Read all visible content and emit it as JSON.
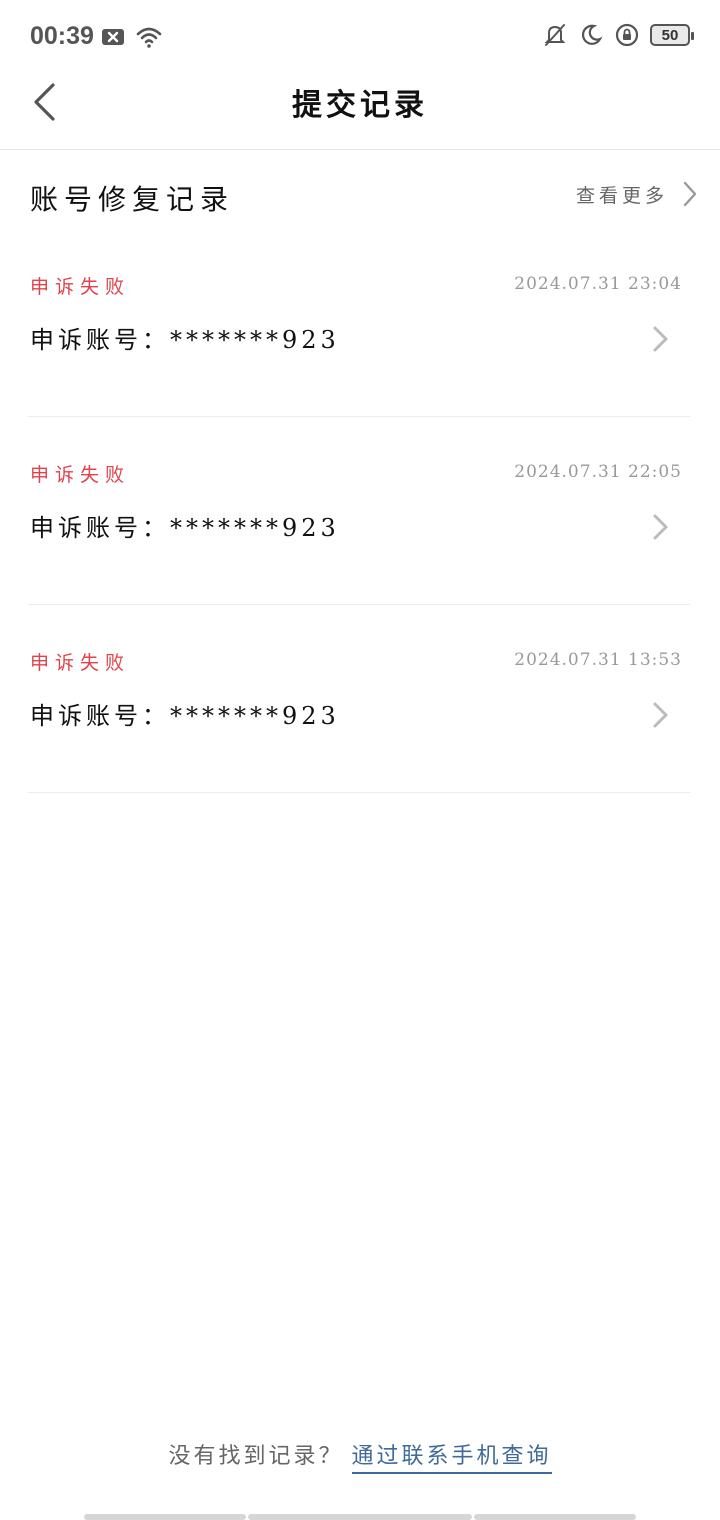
{
  "status_bar": {
    "time": "00:39",
    "battery": "50"
  },
  "nav": {
    "title": "提交记录"
  },
  "section": {
    "title": "账号修复记录",
    "view_more": "查看更多"
  },
  "records": [
    {
      "status": "申诉失败",
      "time": "2024.07.31  23:04",
      "account": "申诉账号：*******923"
    },
    {
      "status": "申诉失败",
      "time": "2024.07.31  22:05",
      "account": "申诉账号：*******923"
    },
    {
      "status": "申诉失败",
      "time": "2024.07.31  13:53",
      "account": "申诉账号：*******923"
    }
  ],
  "footer": {
    "text": "没有找到记录？",
    "link": "通过联系手机查询"
  },
  "colors": {
    "failure": "#e0434b",
    "link": "#3f6a9a"
  }
}
